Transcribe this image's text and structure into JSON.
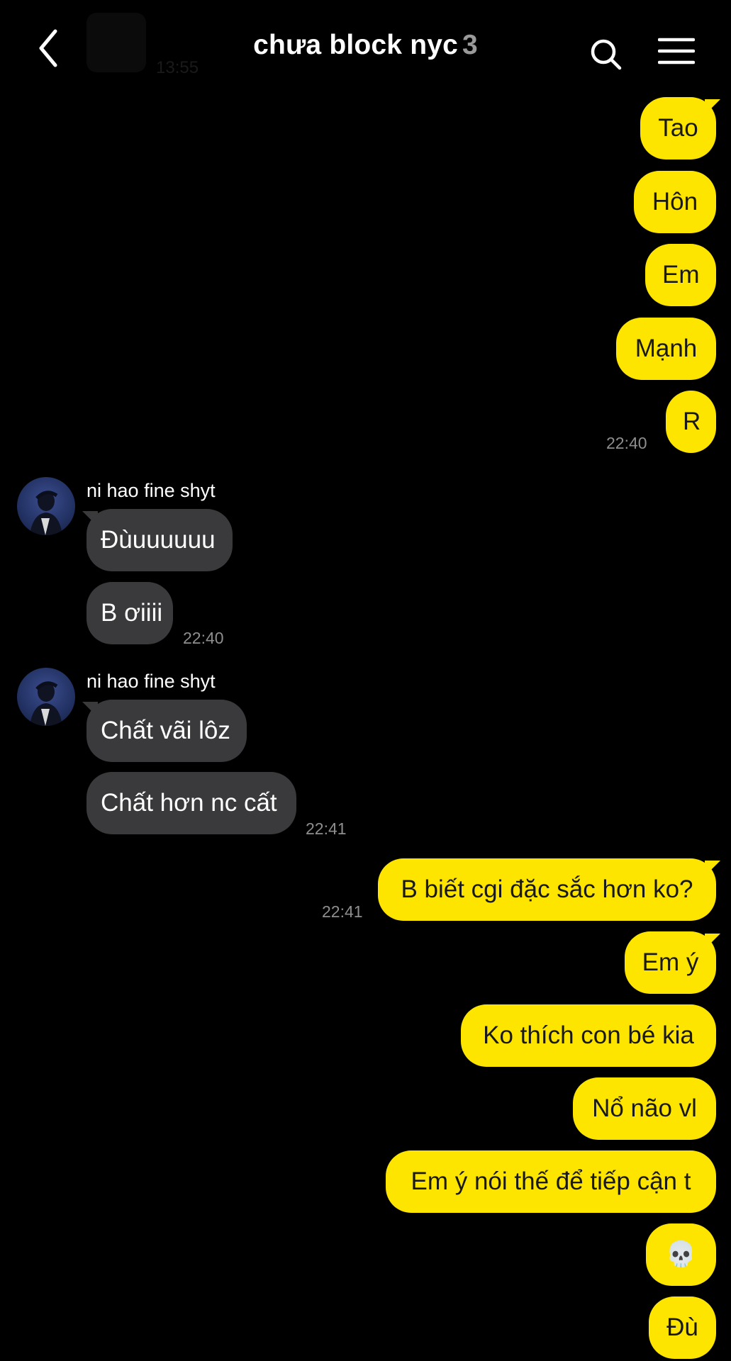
{
  "header": {
    "title": "chưa block nyc",
    "member_count": "3",
    "ghost_time": "13:55"
  },
  "messages_out_1": [
    "Tao",
    "Hôn",
    "Em",
    "Mạnh",
    "R"
  ],
  "time_out_1": "22:40",
  "group_in_1": {
    "sender": "ni hao fine shyt",
    "messages": [
      "Đùuuuuuu",
      "B ơiiii"
    ],
    "time": "22:40"
  },
  "group_in_2": {
    "sender": "ni hao fine shyt",
    "messages": [
      "Chất vãi lôz",
      "Chất hơn nc cất"
    ],
    "time": "22:41"
  },
  "messages_out_2": [
    "B biết cgi đặc sắc hơn ko?",
    "Em ý",
    "Ko thích con bé kia",
    "Nổ não vl",
    "Em ý nói thế để tiếp cận t",
    "💀",
    "Đù"
  ],
  "time_out_2": "22:41",
  "icons": {
    "back": "chevron-left-icon",
    "search": "search-icon",
    "menu": "hamburger-menu-icon",
    "skull": "skull-emoji"
  },
  "colors": {
    "background": "#000000",
    "outgoing_bubble": "#fee500",
    "incoming_bubble": "#3a3a3c",
    "timestamp": "#8e8e8e"
  }
}
